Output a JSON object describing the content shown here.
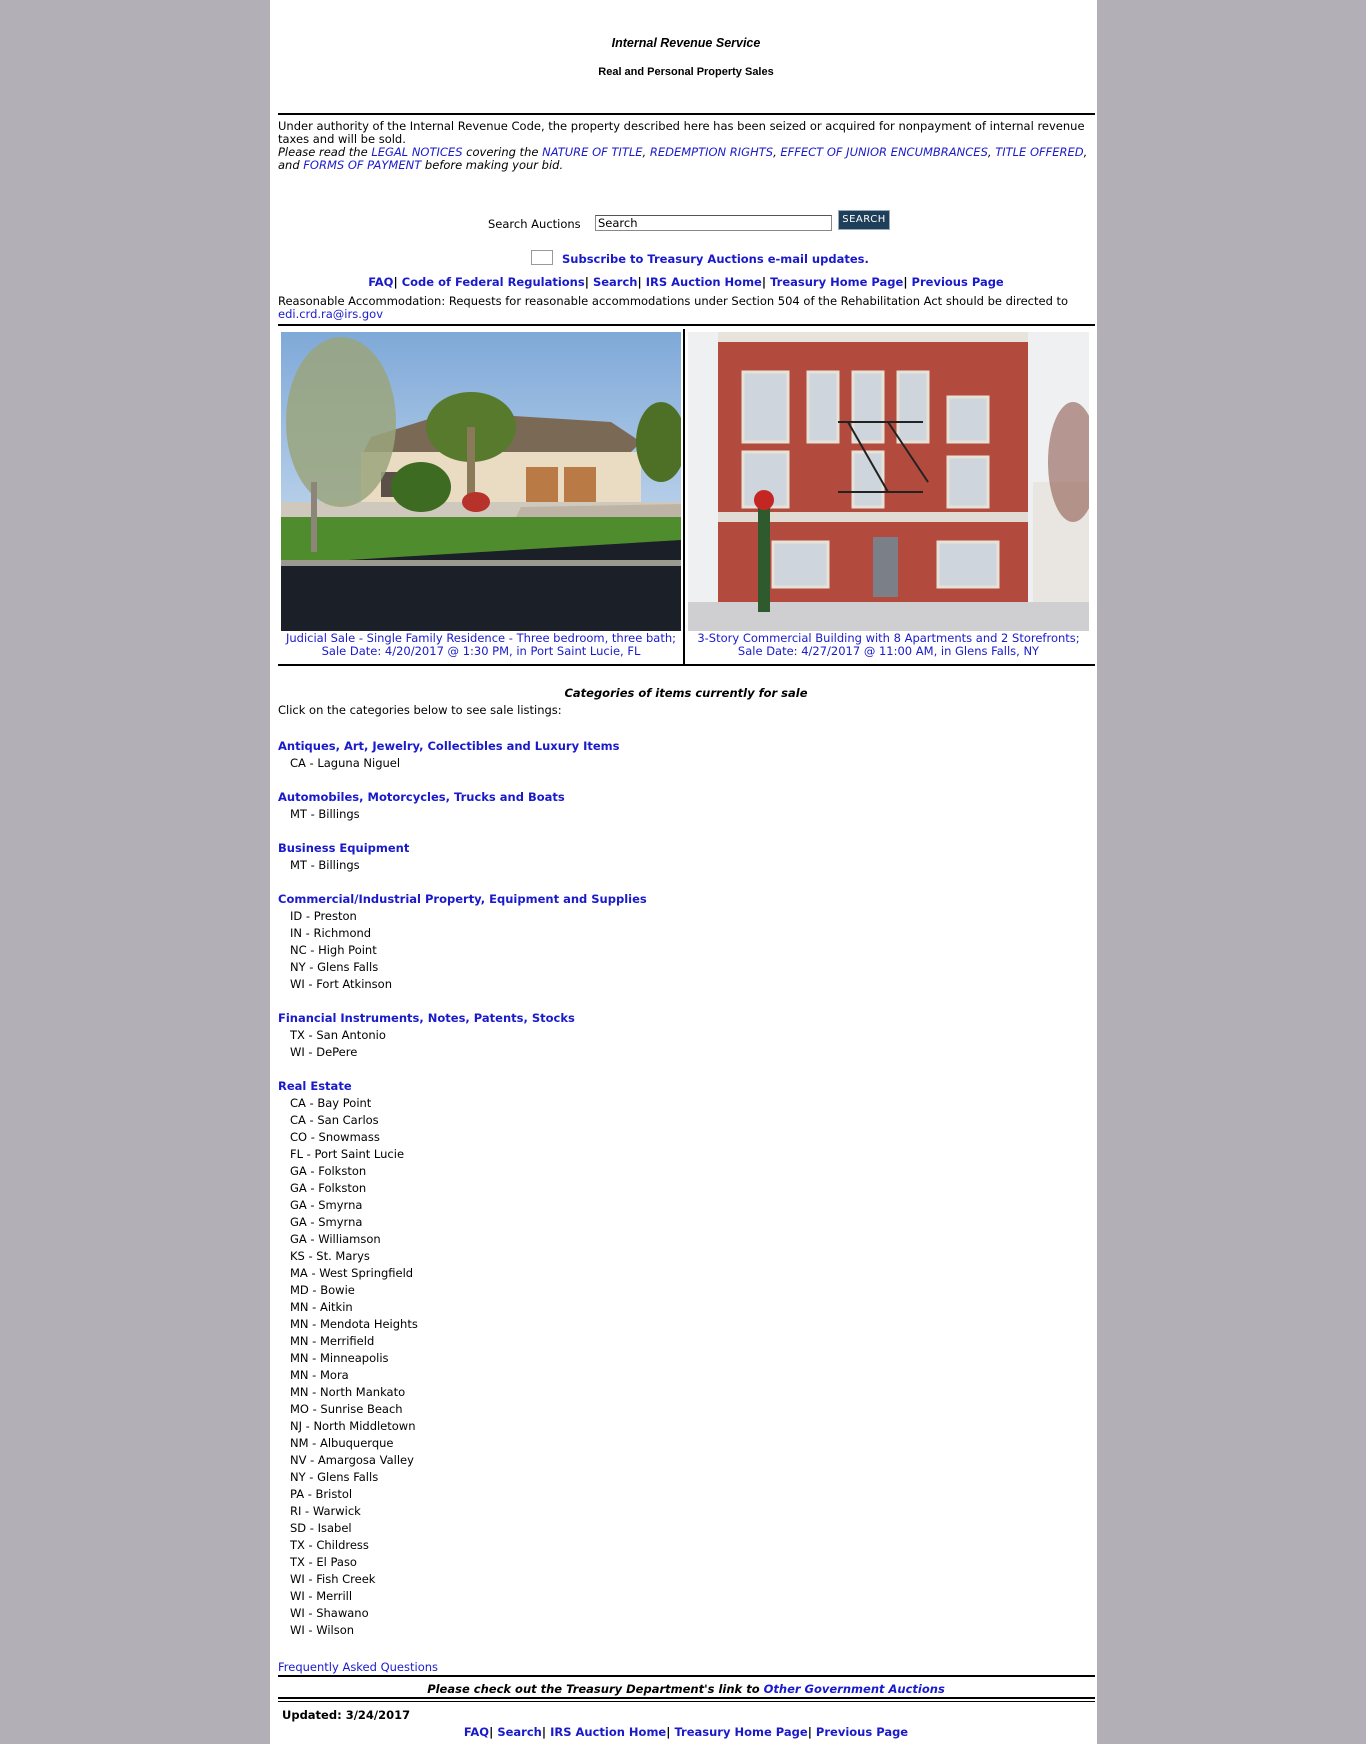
{
  "header": {
    "agency": "Internal Revenue Service",
    "subtitle": "Real and Personal Property Sales"
  },
  "intro": {
    "line1": "Under authority of the Internal Revenue Code, the property described here has been seized or acquired for nonpayment of internal revenue taxes and will be sold.",
    "read_prefix": "Please read the ",
    "legal_notices": "LEGAL NOTICES",
    "covering": " covering the ",
    "nature_of_title": "NATURE OF TITLE",
    "comma1": ", ",
    "redemption_rights": "REDEMPTION RIGHTS",
    "comma2": ", ",
    "junior_encumbrances": "EFFECT OF JUNIOR ENCUMBRANCES",
    "comma3": ", ",
    "title_offered": "TITLE OFFERED",
    "and": ", and ",
    "forms_of_payment": "FORMS OF PAYMENT",
    "suffix": " before making your bid."
  },
  "search": {
    "label": "Search Auctions",
    "value": "Search",
    "button": "SEARCH"
  },
  "subscribe": {
    "label": "Subscribe to Treasury Auctions e-mail updates."
  },
  "nav": {
    "faq": "FAQ",
    "cfr": "Code of Federal Regulations",
    "search": "Search",
    "irs_home": "IRS Auction Home",
    "treasury_home": "Treasury Home Page",
    "previous": "Previous Page",
    "sep": "| "
  },
  "accommodation": {
    "text": "Reasonable Accommodation: Requests for reasonable accommodations under Section 504 of the Rehabilitation Act should be directed to",
    "email": "edi.crd.ra@irs.gov"
  },
  "featured": [
    {
      "caption": "Judicial Sale - Single Family Residence - Three bedroom, three bath; Sale Date: 4/20/2017 @ 1:30 PM, in Port Saint Lucie, FL"
    },
    {
      "caption": "3-Story Commercial Building with 8 Apartments and 2 Storefronts; Sale Date: 4/27/2017 @ 11:00 AM, in Glens Falls, NY"
    }
  ],
  "categories": {
    "title": "Categories of items currently for sale",
    "hint": "Click on the categories below to see sale listings:",
    "groups": [
      {
        "name": "Antiques, Art, Jewelry, Collectibles and Luxury Items",
        "items": [
          "CA - Laguna Niguel"
        ]
      },
      {
        "name": "Automobiles, Motorcycles, Trucks and Boats",
        "items": [
          "MT - Billings"
        ]
      },
      {
        "name": "Business Equipment",
        "items": [
          "MT - Billings"
        ]
      },
      {
        "name": "Commercial/Industrial Property, Equipment and Supplies",
        "items": [
          "ID - Preston",
          "IN - Richmond",
          "NC - High Point",
          "NY - Glens Falls",
          "WI - Fort Atkinson"
        ]
      },
      {
        "name": "Financial Instruments, Notes, Patents, Stocks",
        "items": [
          "TX - San Antonio",
          "WI - DePere"
        ]
      },
      {
        "name": "Real Estate",
        "items": [
          "CA - Bay Point",
          "CA - San Carlos",
          "CO - Snowmass",
          "FL - Port Saint Lucie",
          "GA - Folkston",
          "GA - Folkston",
          "GA - Smyrna",
          "GA - Smyrna",
          "GA - Williamson",
          "KS - St. Marys",
          "MA - West Springfield",
          "MD - Bowie",
          "MN - Aitkin",
          "MN - Mendota Heights",
          "MN - Merrifield",
          "MN - Minneapolis",
          "MN - Mora",
          "MN - North Mankato",
          "MO - Sunrise Beach",
          "NJ - North Middletown",
          "NM - Albuquerque",
          "NV - Amargosa Valley",
          "NY - Glens Falls",
          "PA - Bristol",
          "RI - Warwick",
          "SD - Isabel",
          "TX - Childress",
          "TX - El Paso",
          "WI - Fish Creek",
          "WI - Merrill",
          "WI - Shawano",
          "WI - Wilson"
        ]
      }
    ]
  },
  "footer": {
    "faq_link": "Frequently Asked Questions",
    "other_prefix": "Please check out the Treasury Department's link to ",
    "other_link": "Other Government Auctions",
    "updated": "Updated: 3/24/2017"
  },
  "colors": {
    "link": "#1a1acb",
    "background": "#b3afb6",
    "search_button": "#1f3e59"
  }
}
